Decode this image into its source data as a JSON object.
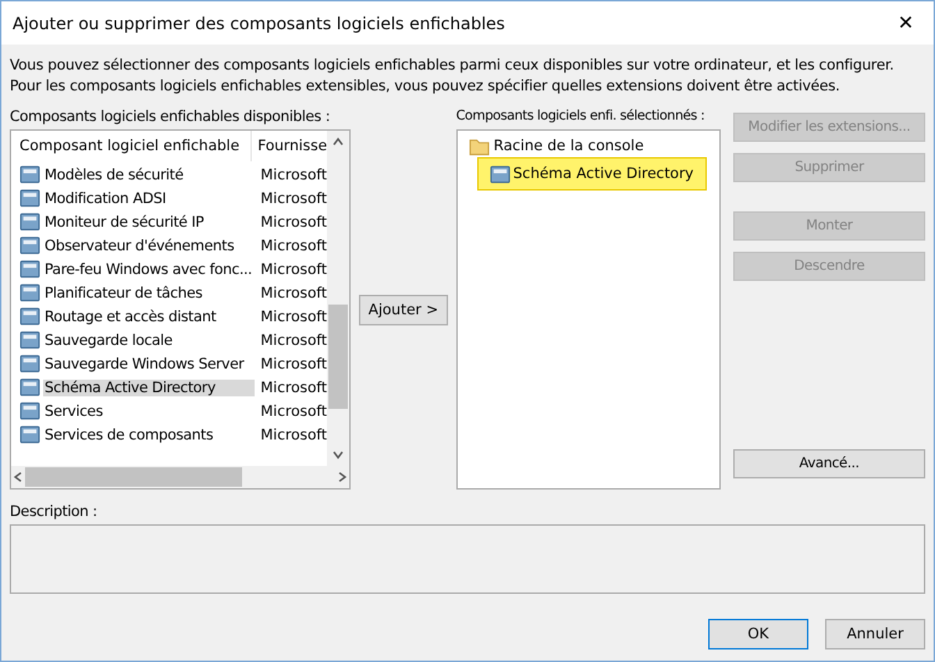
{
  "window": {
    "title": "Ajouter ou supprimer des composants logiciels enfichables",
    "close": "✕"
  },
  "intro": "Vous pouvez sélectionner des composants logiciels enfichables parmi ceux disponibles sur votre ordinateur, et les configurer. Pour les composants logiciels enfichables extensibles, vous pouvez spécifier quelles extensions doivent être activées.",
  "available": {
    "label": "Composants logiciels enfichables disponibles :",
    "columns": [
      "Composant logiciel enfichable",
      "Fournisse"
    ],
    "rows": [
      {
        "name": "Modèles de sécurité",
        "vendor": "Microsoft",
        "selected": false
      },
      {
        "name": "Modification ADSI",
        "vendor": "Microsoft",
        "selected": false
      },
      {
        "name": "Moniteur de sécurité IP",
        "vendor": "Microsoft",
        "selected": false
      },
      {
        "name": "Observateur d'événements",
        "vendor": "Microsoft",
        "selected": false
      },
      {
        "name": "Pare-feu Windows avec fonc...",
        "vendor": "Microsoft",
        "selected": false
      },
      {
        "name": "Planificateur de tâches",
        "vendor": "Microsoft",
        "selected": false
      },
      {
        "name": "Routage et accès distant",
        "vendor": "Microsoft",
        "selected": false
      },
      {
        "name": "Sauvegarde locale",
        "vendor": "Microsoft",
        "selected": false
      },
      {
        "name": "Sauvegarde Windows Server",
        "vendor": "Microsoft",
        "selected": false
      },
      {
        "name": "Schéma Active Directory",
        "vendor": "Microsoft",
        "selected": true
      },
      {
        "name": "Services",
        "vendor": "Microsoft",
        "selected": false
      },
      {
        "name": "Services de composants",
        "vendor": "Microsoft",
        "selected": false
      }
    ]
  },
  "add_button": {
    "label": "Ajouter >"
  },
  "selected_panel": {
    "label": "Composants logiciels enfi. sélectionnés :",
    "tree": [
      {
        "label": "Racine de la console",
        "highlighted": false,
        "children": [
          {
            "label": "Schéma Active Directory",
            "highlighted": true
          }
        ]
      }
    ]
  },
  "side_buttons": [
    {
      "label": "Modifier les extensions...",
      "disabled": true
    },
    {
      "label": "Supprimer",
      "disabled": true
    },
    {
      "label": "Monter",
      "disabled": true
    },
    {
      "label": "Descendre",
      "disabled": true
    }
  ],
  "advanced_button": {
    "label": "Avancé...",
    "disabled": false
  },
  "description": {
    "label": "Description :"
  },
  "buttons": [
    "OK",
    "Annuler"
  ]
}
